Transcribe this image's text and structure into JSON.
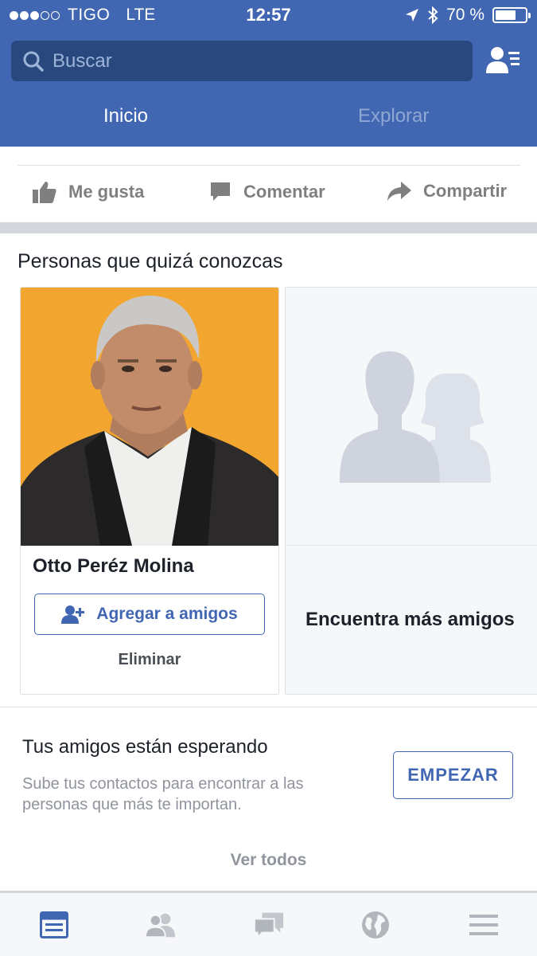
{
  "status_bar": {
    "carrier": "TIGO",
    "network": "LTE",
    "time": "12:57",
    "battery": "70 %",
    "battery_level": 0.7
  },
  "search": {
    "placeholder": "Buscar"
  },
  "top_tabs": {
    "home": "Inicio",
    "explore": "Explorar"
  },
  "actions": {
    "like": "Me gusta",
    "comment": "Comentar",
    "share": "Compartir"
  },
  "pymk": {
    "title": "Personas que quizá conozcas",
    "person_name": "Otto Peréz Molina",
    "add_friend": "Agregar a amigos",
    "remove": "Eliminar",
    "find_more": "Encuentra más amigos"
  },
  "contacts": {
    "title": "Tus amigos están esperando",
    "description": "Sube tus contactos para encontrar a las personas que más te importan.",
    "start": "EMPEZAR",
    "see_all": "Ver todos"
  },
  "bottom_tabs": [
    "news-feed-icon",
    "friends-icon",
    "messages-icon",
    "globe-icon",
    "menu-icon"
  ],
  "colors": {
    "brand_blue": "#4267b2",
    "search_bg": "#29487d",
    "photo_bg": "#f2a62f",
    "muted_text": "#90949c"
  }
}
